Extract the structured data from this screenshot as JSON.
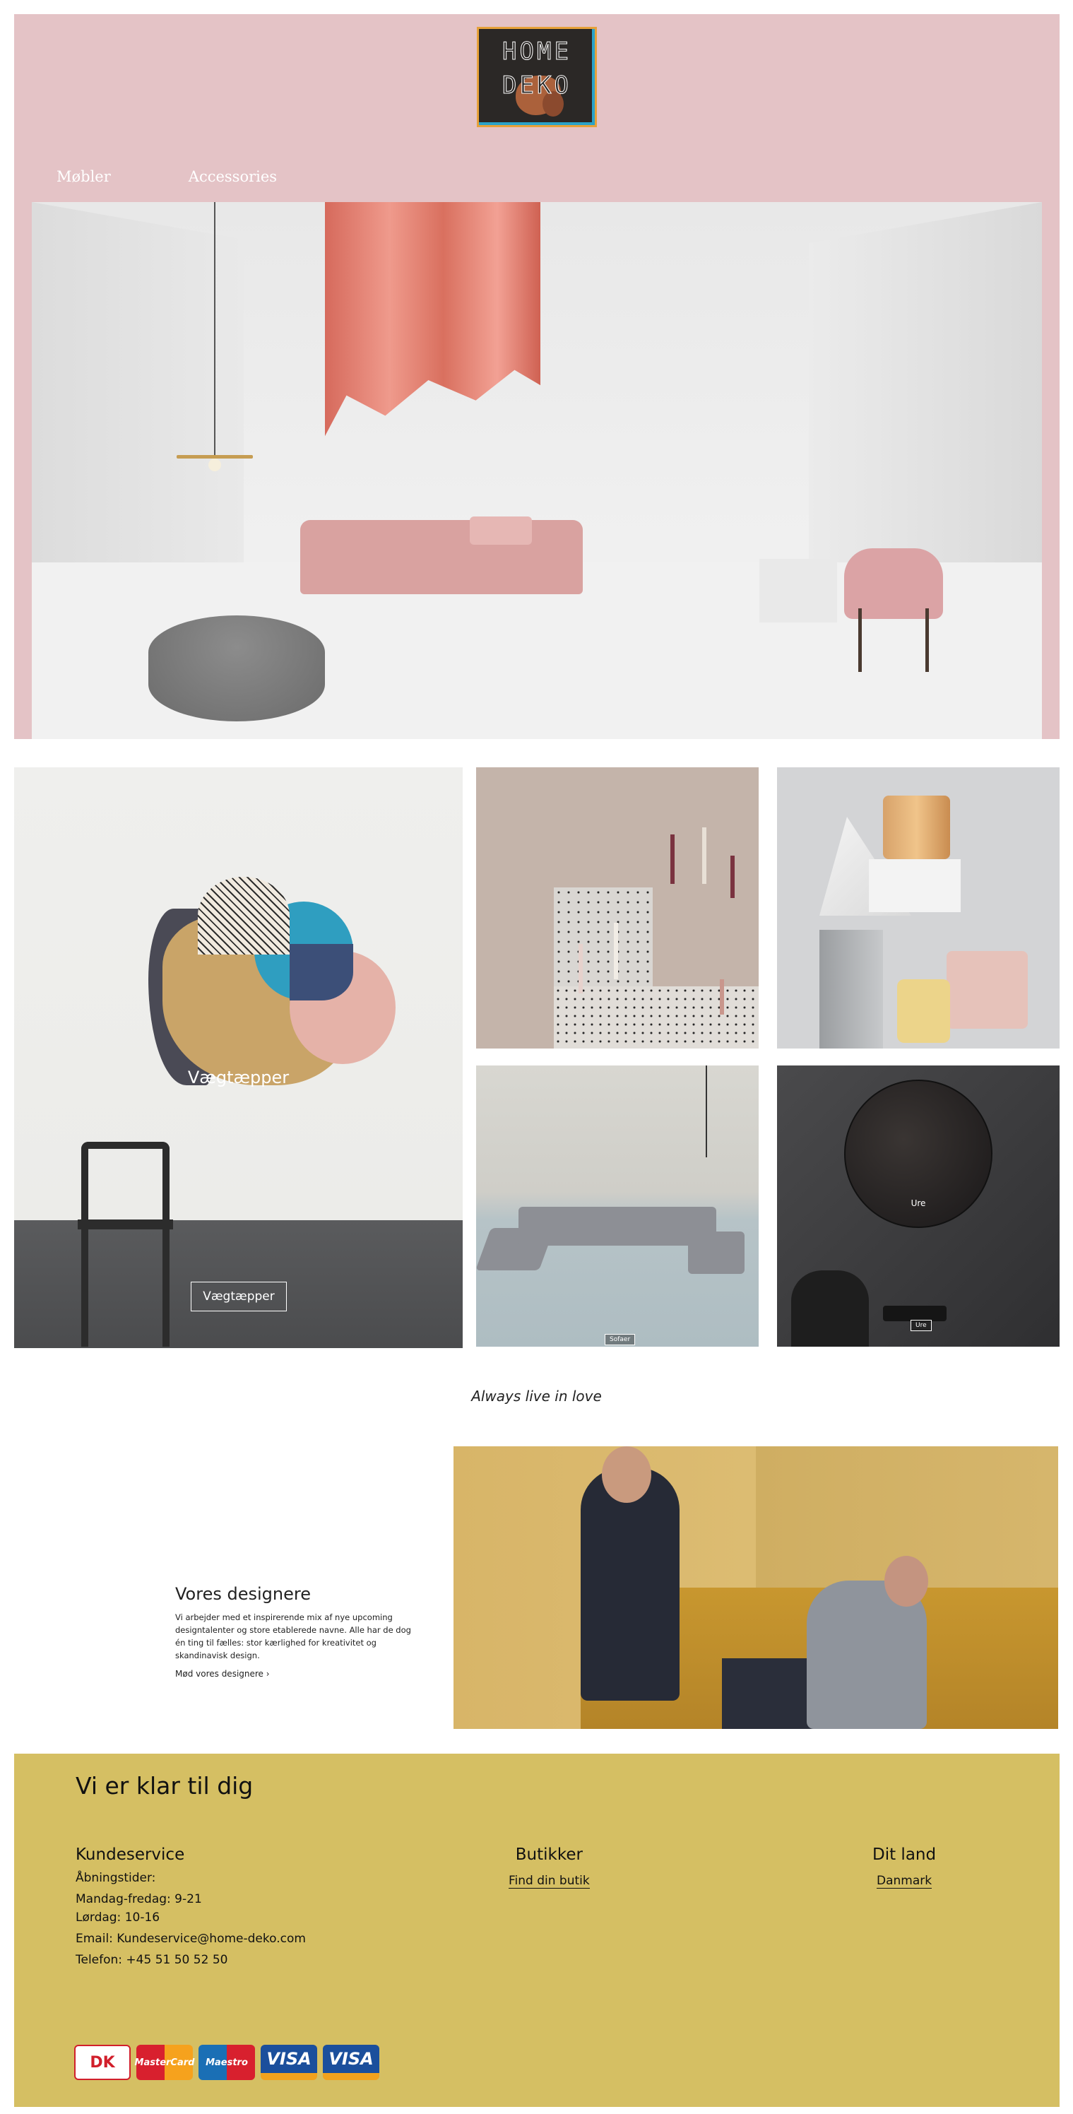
{
  "header": {
    "logo_line1": "HOME",
    "logo_line2": "DEKO",
    "nav": [
      "Møbler",
      "Accessories"
    ]
  },
  "categories": {
    "big": {
      "overlay": "Vægtæpper",
      "button": "Vægtæpper"
    },
    "tile_clock_label": "Ure",
    "tile_clock_button": "Ure",
    "tile_sofa_button": "Sofaer"
  },
  "tagline": "Always live in love",
  "designers": {
    "title": "Vores designere",
    "body": "Vi arbejder med et inspirerende mix af nye upcoming designtalenter og store etablerede navne. Alle har de dog én ting til fælles: stor kærlighed for kreativitet og skandinavisk design.",
    "link": "Mød vores designere ›"
  },
  "footer": {
    "title": "Vi er klar til dig",
    "kundeservice": {
      "heading": "Kundeservice",
      "hours_label": "Åbningstider:",
      "weekdays": "Mandag-fredag: 9-21",
      "saturday": "Lørdag: 10-16",
      "email": "Email: Kundeservice@home-deko.com",
      "phone": "Telefon: +45 51 50 52 50"
    },
    "butikker": {
      "heading": "Butikker",
      "link": "Find din butik"
    },
    "land": {
      "heading": "Dit land",
      "link": "Danmark"
    },
    "payments": [
      "DK",
      "MasterCard",
      "Maestro",
      "VISA",
      "VISA"
    ]
  },
  "colors": {
    "header_bg": "#e4c3c6",
    "footer_bg": "#d5bf63"
  }
}
